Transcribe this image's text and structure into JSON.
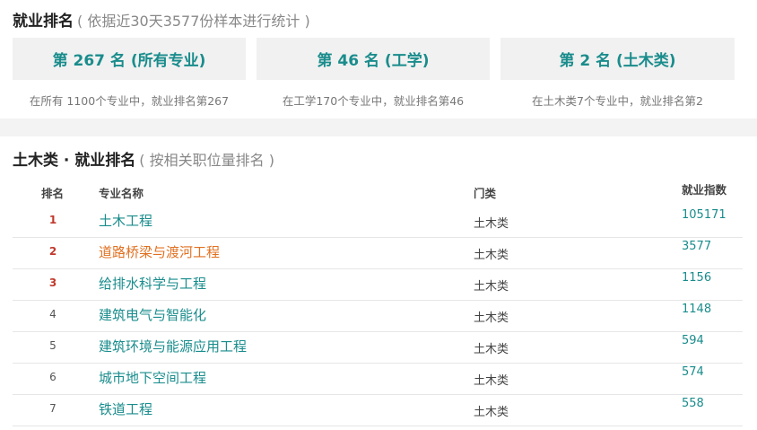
{
  "ranking": {
    "title": "就业排名",
    "subtitle": "( 依据近30天3577份样本进行统计 )",
    "cards": [
      {
        "label": "第 267 名 (所有专业)",
        "note": "在所有 1100个专业中，就业排名第267"
      },
      {
        "label": "第 46 名 (工学)",
        "note": "在工学170个专业中，就业排名第46"
      },
      {
        "label": "第 2 名 (土木类)",
        "note": "在土木类7个专业中，就业排名第2"
      }
    ]
  },
  "category_ranking": {
    "title": "土木类 · 就业排名",
    "subtitle": "( 按相关职位量排名 )",
    "headers": {
      "rank": "排名",
      "name": "专业名称",
      "category": "门类",
      "index": "就业指数"
    },
    "rows": [
      {
        "rank": "1",
        "name": "土木工程",
        "category": "土木类",
        "index": "105171"
      },
      {
        "rank": "2",
        "name": "道路桥梁与渡河工程",
        "category": "土木类",
        "index": "3577"
      },
      {
        "rank": "3",
        "name": "给排水科学与工程",
        "category": "土木类",
        "index": "1156"
      },
      {
        "rank": "4",
        "name": "建筑电气与智能化",
        "category": "土木类",
        "index": "1148"
      },
      {
        "rank": "5",
        "name": "建筑环境与能源应用工程",
        "category": "土木类",
        "index": "594"
      },
      {
        "rank": "6",
        "name": "城市地下空间工程",
        "category": "土木类",
        "index": "574"
      },
      {
        "rank": "7",
        "name": "铁道工程",
        "category": "土木类",
        "index": "558"
      }
    ]
  },
  "colors": {
    "accent": "#1a8c8c",
    "highlight": "#e07020",
    "top_rank": "#c0392b"
  }
}
